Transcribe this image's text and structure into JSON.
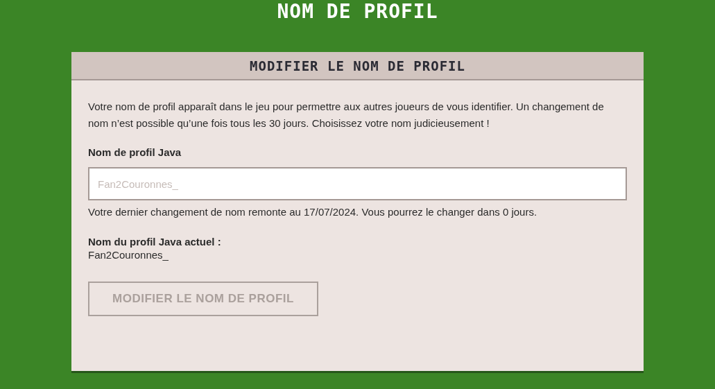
{
  "page_title": "NOM DE PROFIL",
  "card": {
    "title": "MODIFIER LE NOM DE PROFIL",
    "description": "Votre nom de profil apparaît dans le jeu pour permettre aux autres joueurs de vous identifier. Un changement de nom n’est possible qu’une fois tous les 30 jours. Choisissez votre nom judicieusement !",
    "field": {
      "label": "Nom de profil Java",
      "placeholder": "Fan2Couronnes_"
    },
    "note": "Votre dernier changement de nom remonte au 17/07/2024. Vous pourrez le changer dans 0 jours.",
    "current_label": "Nom du profil Java actuel :",
    "current_value": "Fan2Couronnes_",
    "button": {
      "label": "MODIFIER LE NOM DE PROFIL",
      "disabled": true
    }
  }
}
